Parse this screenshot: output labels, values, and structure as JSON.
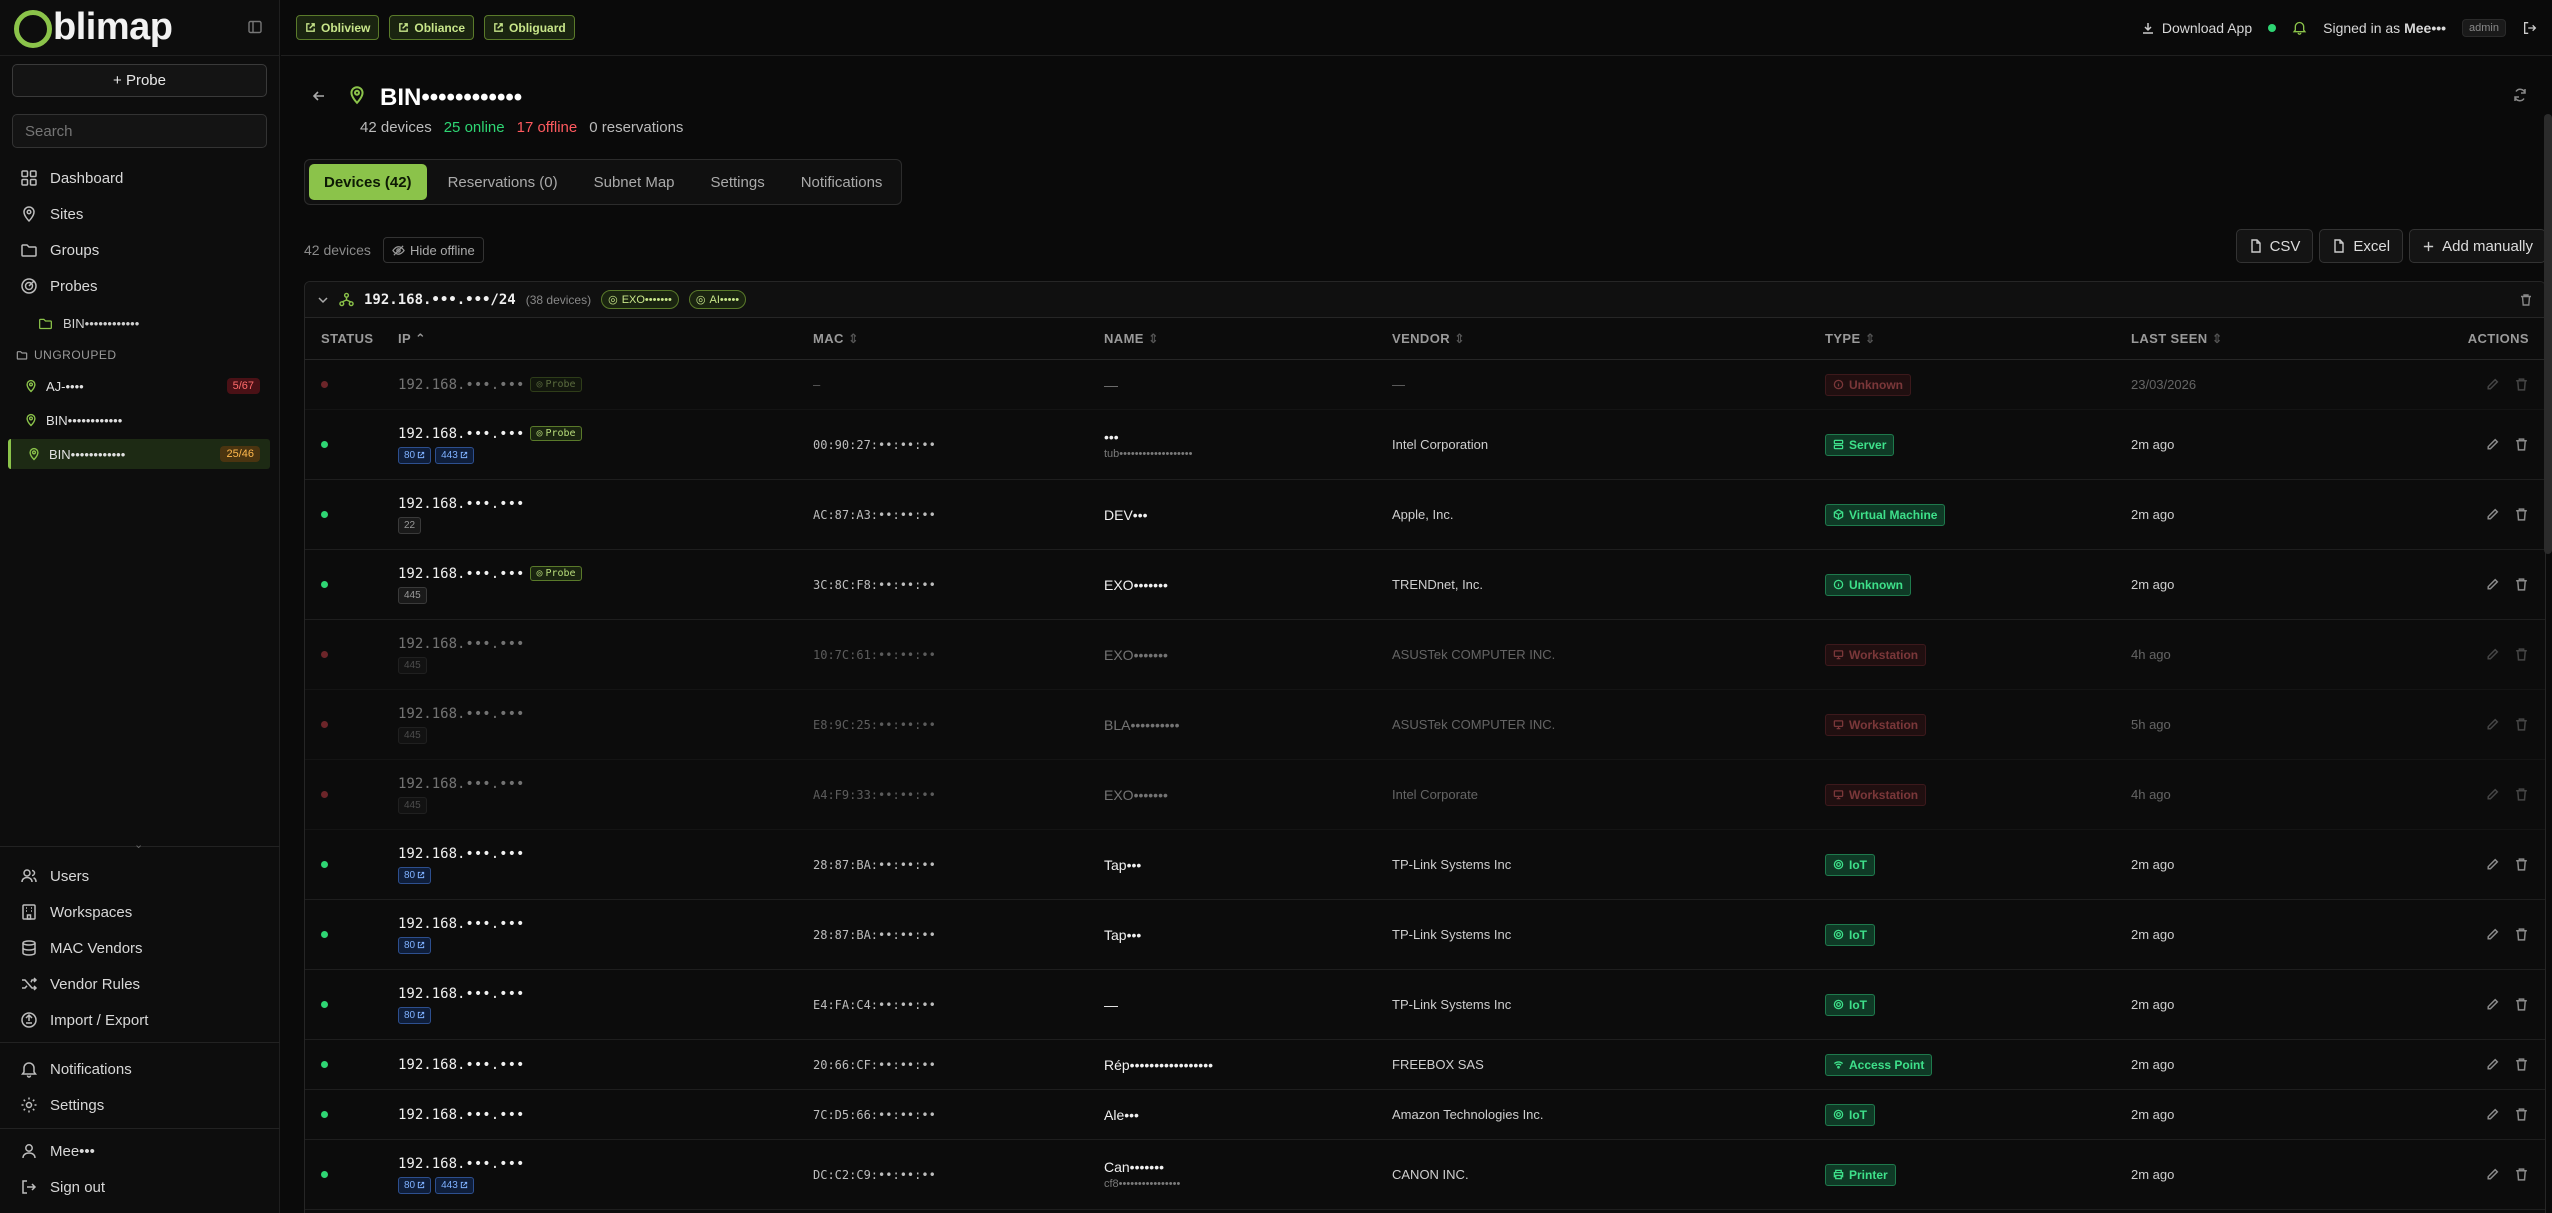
{
  "app": {
    "name": "Oblimap",
    "logo_rest": "blimap",
    "apps": [
      "Obliview",
      "Obliance",
      "Obliguard"
    ]
  },
  "topbar": {
    "download": "Download App",
    "signed_in_prefix": "Signed in as",
    "user": "Mee•••",
    "role": "admin"
  },
  "sidebar": {
    "probe_button": "+ Probe",
    "search_placeholder": "Search",
    "nav": [
      {
        "label": "Dashboard",
        "icon": "dashboard-icon"
      },
      {
        "label": "Sites",
        "icon": "map-pin-icon"
      },
      {
        "label": "Groups",
        "icon": "folder-icon"
      },
      {
        "label": "Probes",
        "icon": "radar-icon"
      }
    ],
    "probe_sub": "BIN••••••••••••",
    "group_label": "UNGROUPED",
    "sites": [
      {
        "label": "AJ-••••",
        "badge": "5/67",
        "tone": "red"
      },
      {
        "label": "BIN••••••••••••",
        "badge": "",
        "tone": ""
      },
      {
        "label": "BIN••••••••••••",
        "badge": "25/46",
        "tone": "amber"
      }
    ],
    "admin_nav": [
      "Users",
      "Workspaces",
      "MAC Vendors",
      "Vendor Rules",
      "Import / Export"
    ],
    "bottom_nav": [
      "Notifications",
      "Settings"
    ],
    "user_label": "Mee•••",
    "signout": "Sign out"
  },
  "site": {
    "title": "BIN••••••••••••",
    "devices": "42 devices",
    "online": "25 online",
    "offline": "17 offline",
    "reservations": "0 reservations"
  },
  "tabs": [
    "Devices (42)",
    "Reservations (0)",
    "Subnet Map",
    "Settings",
    "Notifications"
  ],
  "toolbar": {
    "count": "42 devices",
    "hide_offline": "Hide offline",
    "csv": "CSV",
    "excel": "Excel",
    "add": "Add manually"
  },
  "subnet": {
    "label": "192.168.•••.•••/24",
    "count": "(38 devices)",
    "probes": [
      "EXO•••••••",
      "AI•••••"
    ]
  },
  "columns": [
    "STATUS",
    "IP",
    "MAC",
    "NAME",
    "VENDOR",
    "TYPE",
    "LAST SEEN",
    "ACTIONS"
  ],
  "rows": [
    {
      "online": false,
      "dim": true,
      "ip": "192.168.•••.•••",
      "probe": "Probe",
      "ports": [],
      "mac": "—",
      "name": "—",
      "name_sub": "",
      "vendor": "—",
      "type": "Unknown",
      "type_tone": "red",
      "seen": "23/03/2026",
      "h": 50
    },
    {
      "online": true,
      "dim": false,
      "ip": "192.168.•••.•••",
      "probe": "Probe",
      "ports": [
        {
          "p": "80",
          "link": true
        },
        {
          "p": "443",
          "link": true
        }
      ],
      "mac": "00:90:27:••:••:••",
      "name": "•••",
      "name_sub": "tub•••••••••••••••••••",
      "vendor": "Intel Corporation",
      "type": "Server",
      "type_tone": "green",
      "seen": "2m ago",
      "h": 70
    },
    {
      "online": true,
      "dim": false,
      "ip": "192.168.•••.•••",
      "probe": "",
      "ports": [
        {
          "p": "22",
          "link": false
        }
      ],
      "mac": "AC:87:A3:••:••:••",
      "name": "DEV•••",
      "name_sub": "",
      "vendor": "Apple, Inc.",
      "type": "Virtual Machine",
      "type_tone": "green",
      "seen": "2m ago",
      "h": 70
    },
    {
      "online": true,
      "dim": false,
      "ip": "192.168.•••.•••",
      "probe": "Probe",
      "ports": [
        {
          "p": "445",
          "link": false
        }
      ],
      "mac": "3C:8C:F8:••:••:••",
      "name": "EXO•••••••",
      "name_sub": "",
      "vendor": "TRENDnet, Inc.",
      "type": "Unknown",
      "type_tone": "green",
      "seen": "2m ago",
      "h": 70
    },
    {
      "online": false,
      "dim": true,
      "ip": "192.168.•••.•••",
      "probe": "",
      "ports": [
        {
          "p": "445",
          "link": false
        }
      ],
      "mac": "10:7C:61:••:••:••",
      "name": "EXO•••••••",
      "name_sub": "",
      "vendor": "ASUSTek COMPUTER INC.",
      "type": "Workstation",
      "type_tone": "red",
      "seen": "4h ago",
      "h": 70
    },
    {
      "online": false,
      "dim": true,
      "ip": "192.168.•••.•••",
      "probe": "",
      "ports": [
        {
          "p": "445",
          "link": false
        }
      ],
      "mac": "E8:9C:25:••:••:••",
      "name": "BLA••••••••••",
      "name_sub": "",
      "vendor": "ASUSTek COMPUTER INC.",
      "type": "Workstation",
      "type_tone": "red",
      "seen": "5h ago",
      "h": 70
    },
    {
      "online": false,
      "dim": true,
      "ip": "192.168.•••.•••",
      "probe": "",
      "ports": [
        {
          "p": "445",
          "link": false
        }
      ],
      "mac": "A4:F9:33:••:••:••",
      "name": "EXO•••••••",
      "name_sub": "",
      "vendor": "Intel Corporate",
      "type": "Workstation",
      "type_tone": "red",
      "seen": "4h ago",
      "h": 70
    },
    {
      "online": true,
      "dim": false,
      "ip": "192.168.•••.•••",
      "probe": "",
      "ports": [
        {
          "p": "80",
          "link": true
        }
      ],
      "mac": "28:87:BA:••:••:••",
      "name": "Tap•••",
      "name_sub": "",
      "vendor": "TP-Link Systems Inc",
      "type": "IoT",
      "type_tone": "green",
      "seen": "2m ago",
      "h": 70
    },
    {
      "online": true,
      "dim": false,
      "ip": "192.168.•••.•••",
      "probe": "",
      "ports": [
        {
          "p": "80",
          "link": true
        }
      ],
      "mac": "28:87:BA:••:••:••",
      "name": "Tap•••",
      "name_sub": "",
      "vendor": "TP-Link Systems Inc",
      "type": "IoT",
      "type_tone": "green",
      "seen": "2m ago",
      "h": 70
    },
    {
      "online": true,
      "dim": false,
      "ip": "192.168.•••.•••",
      "probe": "",
      "ports": [
        {
          "p": "80",
          "link": true
        }
      ],
      "mac": "E4:FA:C4:••:••:••",
      "name": "—",
      "name_sub": "",
      "vendor": "TP-Link Systems Inc",
      "type": "IoT",
      "type_tone": "green",
      "seen": "2m ago",
      "h": 70
    },
    {
      "online": true,
      "dim": false,
      "ip": "192.168.•••.•••",
      "probe": "",
      "ports": [],
      "mac": "20:66:CF:••:••:••",
      "name": "Rép•••••••••••••••••",
      "name_sub": "",
      "vendor": "FREEBOX SAS",
      "type": "Access Point",
      "type_tone": "green",
      "seen": "2m ago",
      "h": 50
    },
    {
      "online": true,
      "dim": false,
      "ip": "192.168.•••.•••",
      "probe": "",
      "ports": [],
      "mac": "7C:D5:66:••:••:••",
      "name": "Ale•••",
      "name_sub": "",
      "vendor": "Amazon Technologies Inc.",
      "type": "IoT",
      "type_tone": "green",
      "seen": "2m ago",
      "h": 50
    },
    {
      "online": true,
      "dim": false,
      "ip": "192.168.•••.•••",
      "probe": "",
      "ports": [
        {
          "p": "80",
          "link": true
        },
        {
          "p": "443",
          "link": true
        }
      ],
      "mac": "DC:C2:C9:••:••:••",
      "name": "Can•••••••",
      "name_sub": "cf8••••••••••••••••",
      "vendor": "CANON INC.",
      "type": "Printer",
      "type_tone": "green",
      "seen": "2m ago",
      "h": 70
    }
  ]
}
